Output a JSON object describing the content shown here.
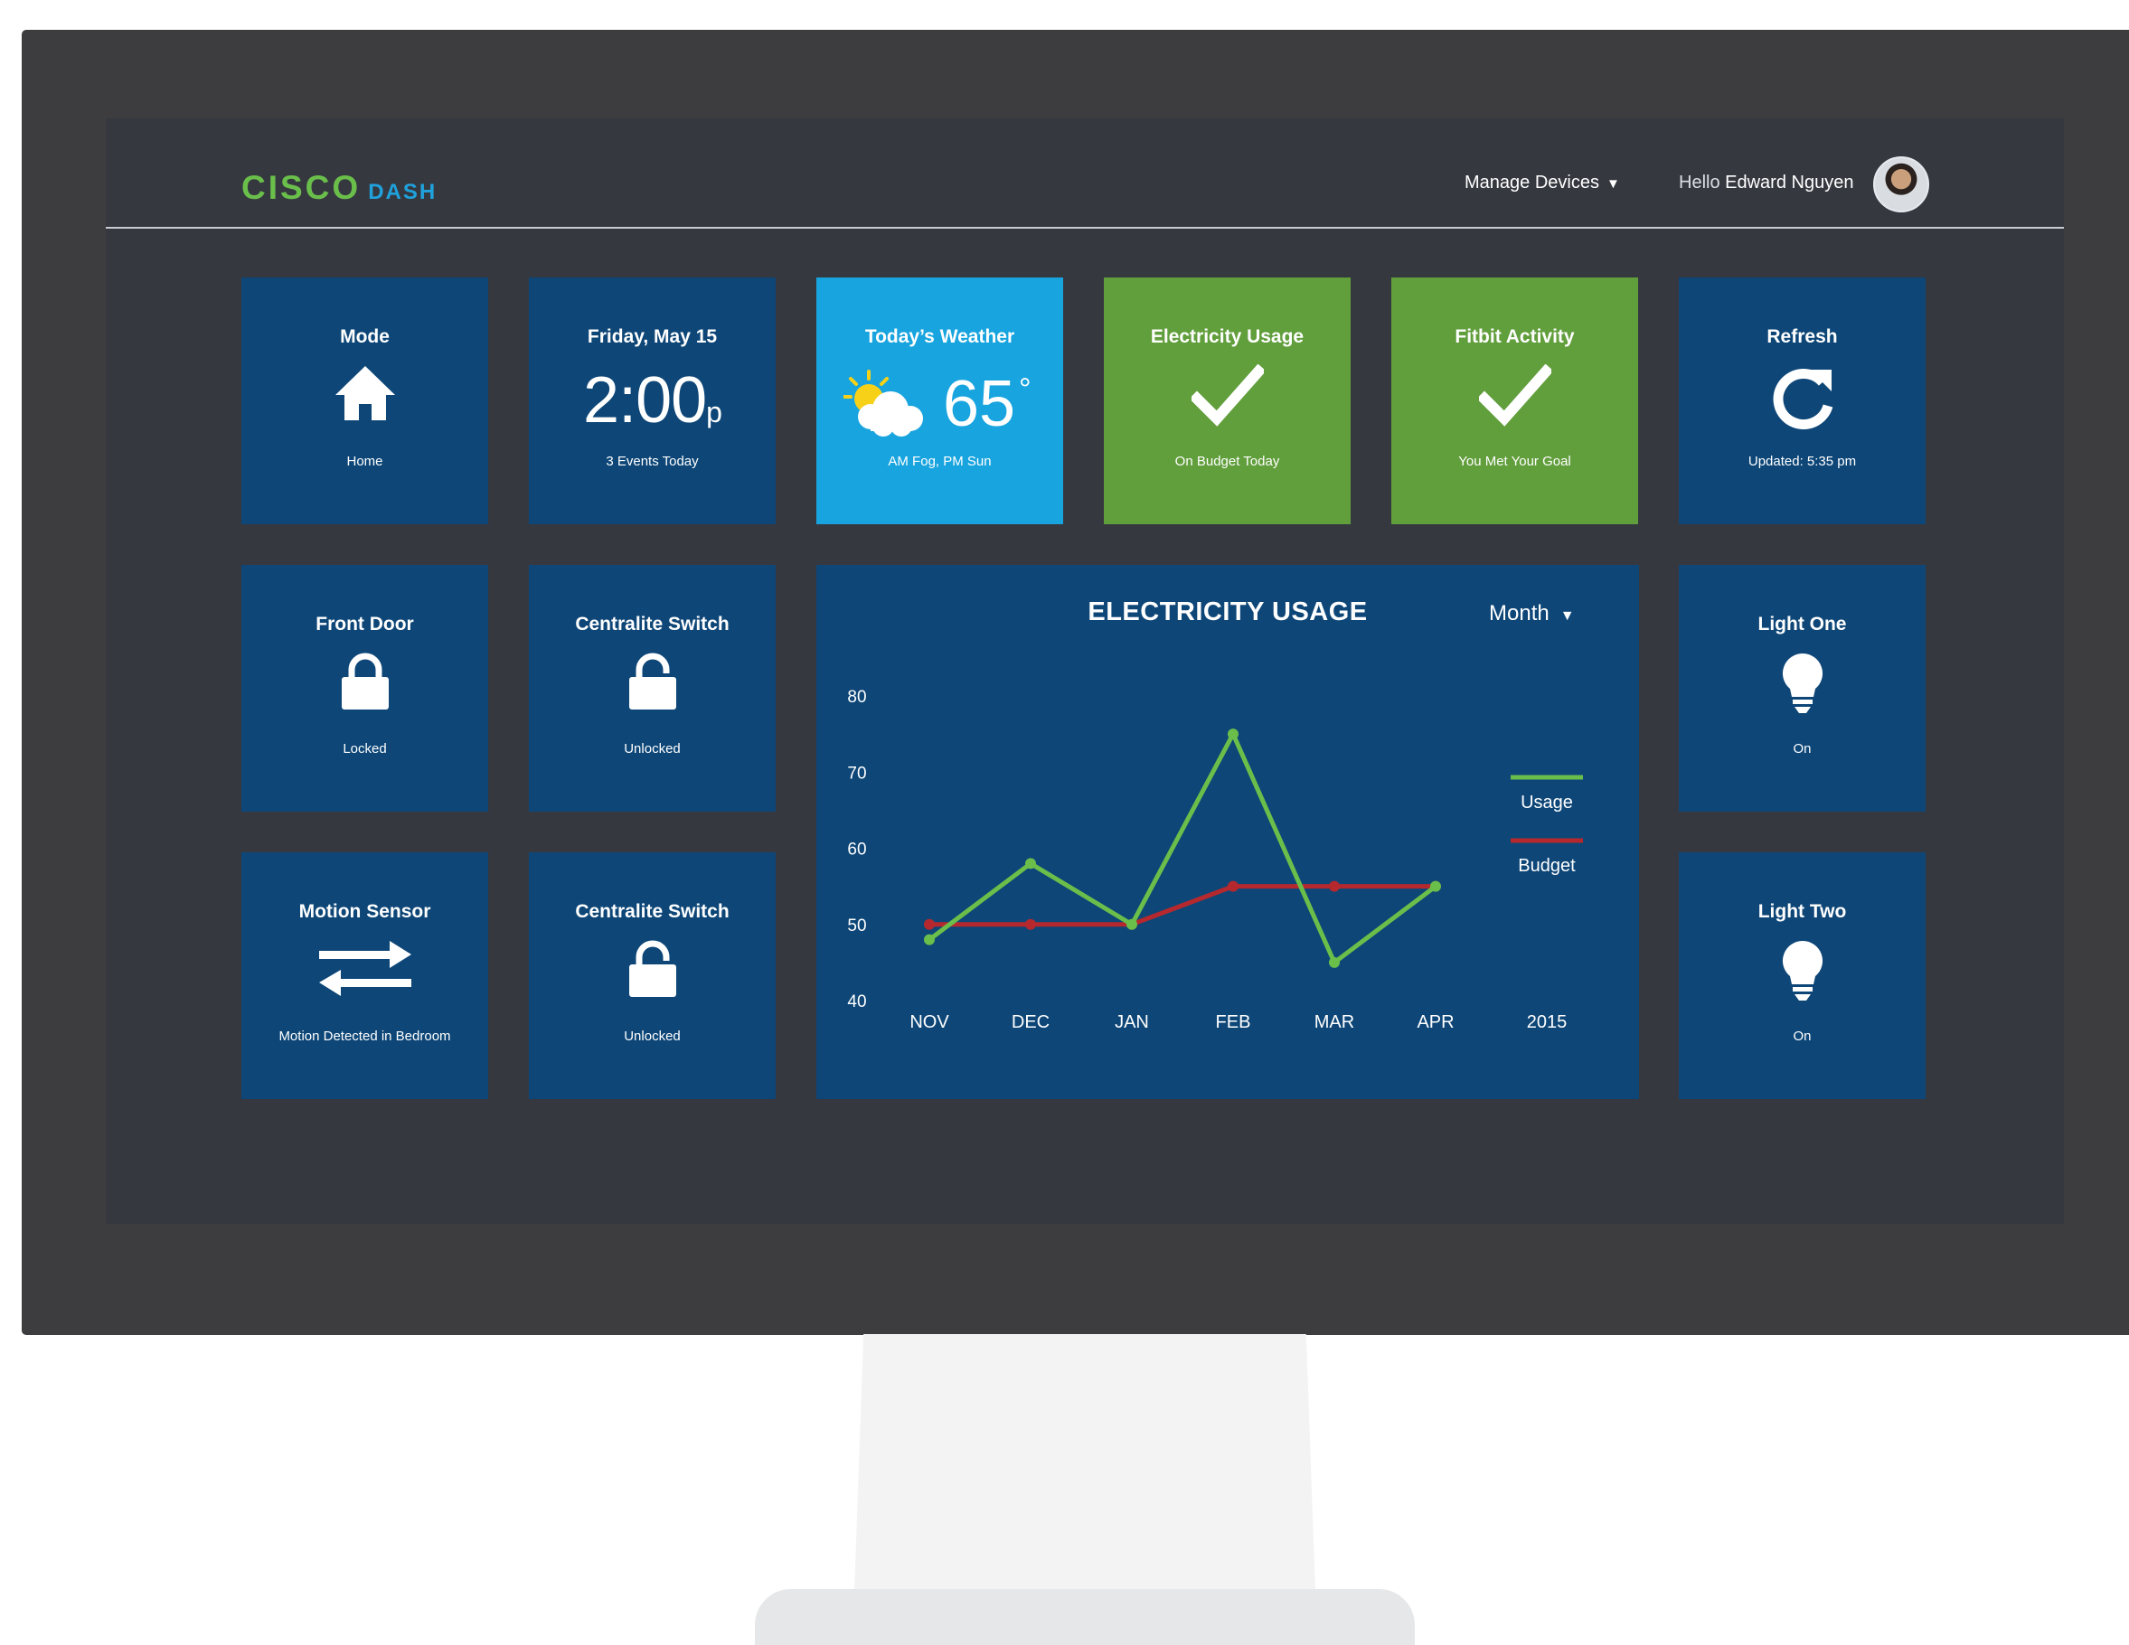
{
  "brand": {
    "logo_main": "CISCO",
    "logo_sub": "DASH"
  },
  "header": {
    "manage_devices": "Manage Devices",
    "hello": "Hello",
    "user_name": "Edward Nguyen"
  },
  "tiles": {
    "mode": {
      "title": "Mode",
      "sub": "Home",
      "icon": "home-icon"
    },
    "date": {
      "title": "Friday, May 15",
      "time": "2:00",
      "ampm": "p",
      "sub": "3 Events Today"
    },
    "weather": {
      "title": "Today’s Weather",
      "temp": "65",
      "deg": "°",
      "sub": "AM Fog, PM Sun",
      "icon": "partly-cloudy-icon"
    },
    "electricity": {
      "title": "Electricity Usage",
      "sub": "On Budget Today",
      "icon": "check-icon"
    },
    "fitbit": {
      "title": "Fitbit Activity",
      "sub": "You Met Your Goal",
      "icon": "check-icon"
    },
    "refresh": {
      "title": "Refresh",
      "sub": "Updated: 5:35 pm",
      "icon": "refresh-icon"
    },
    "front_door": {
      "title": "Front Door",
      "sub": "Locked",
      "icon": "lock-icon"
    },
    "centralite_1": {
      "title": "Centralite Switch",
      "sub": "Unlocked",
      "icon": "unlock-icon"
    },
    "motion": {
      "title": "Motion Sensor",
      "sub": "Motion Detected in Bedroom",
      "icon": "motion-arrows-icon"
    },
    "centralite_2": {
      "title": "Centralite Switch",
      "sub": "Unlocked",
      "icon": "unlock-icon"
    },
    "light_one": {
      "title": "Light One",
      "sub": "On",
      "icon": "lightbulb-icon"
    },
    "light_two": {
      "title": "Light Two",
      "sub": "On",
      "icon": "lightbulb-icon"
    }
  },
  "colors": {
    "tile_blue": "#0d4677",
    "weather_blue": "#18a4df",
    "tile_green": "#619e3c",
    "usage_line": "#6abf4b",
    "budget_line": "#b5292e",
    "logo_green": "#6abf4b",
    "logo_blue": "#1fa2dc"
  },
  "chart_data": {
    "type": "line",
    "title": "ELECTRICITY USAGE",
    "period_selector": "Month",
    "categories": [
      "NOV",
      "DEC",
      "JAN",
      "FEB",
      "MAR",
      "APR"
    ],
    "year_label": "2015",
    "yticks": [
      40,
      50,
      60,
      70,
      80
    ],
    "ylim": [
      40,
      80
    ],
    "series": [
      {
        "name": "Usage",
        "values": [
          48,
          58,
          50,
          75,
          45,
          55
        ],
        "color": "#6abf4b"
      },
      {
        "name": "Budget",
        "values": [
          50,
          50,
          50,
          55,
          55,
          55
        ],
        "color": "#b5292e"
      }
    ],
    "legend_position": "right",
    "grid": false
  }
}
